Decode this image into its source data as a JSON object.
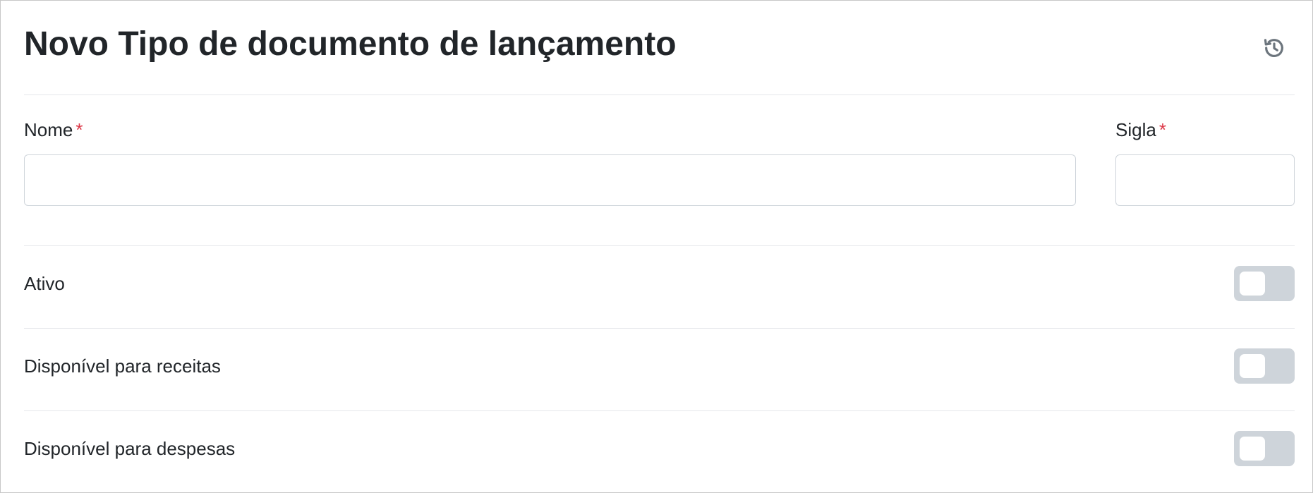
{
  "header": {
    "title": "Novo Tipo de documento de lançamento",
    "history_icon": "history-icon"
  },
  "form": {
    "nome": {
      "label": "Nome",
      "required_mark": "*",
      "value": "",
      "placeholder": ""
    },
    "sigla": {
      "label": "Sigla",
      "required_mark": "*",
      "value": "",
      "placeholder": ""
    },
    "toggles": [
      {
        "label": "Ativo",
        "checked": false
      },
      {
        "label": "Disponível para receitas",
        "checked": false
      },
      {
        "label": "Disponível para despesas",
        "checked": false
      }
    ]
  },
  "colors": {
    "text": "#212529",
    "required": "#dc3545",
    "toggle_off": "#ced4da",
    "divider": "#e5e7eb",
    "icon": "#6c757d"
  }
}
